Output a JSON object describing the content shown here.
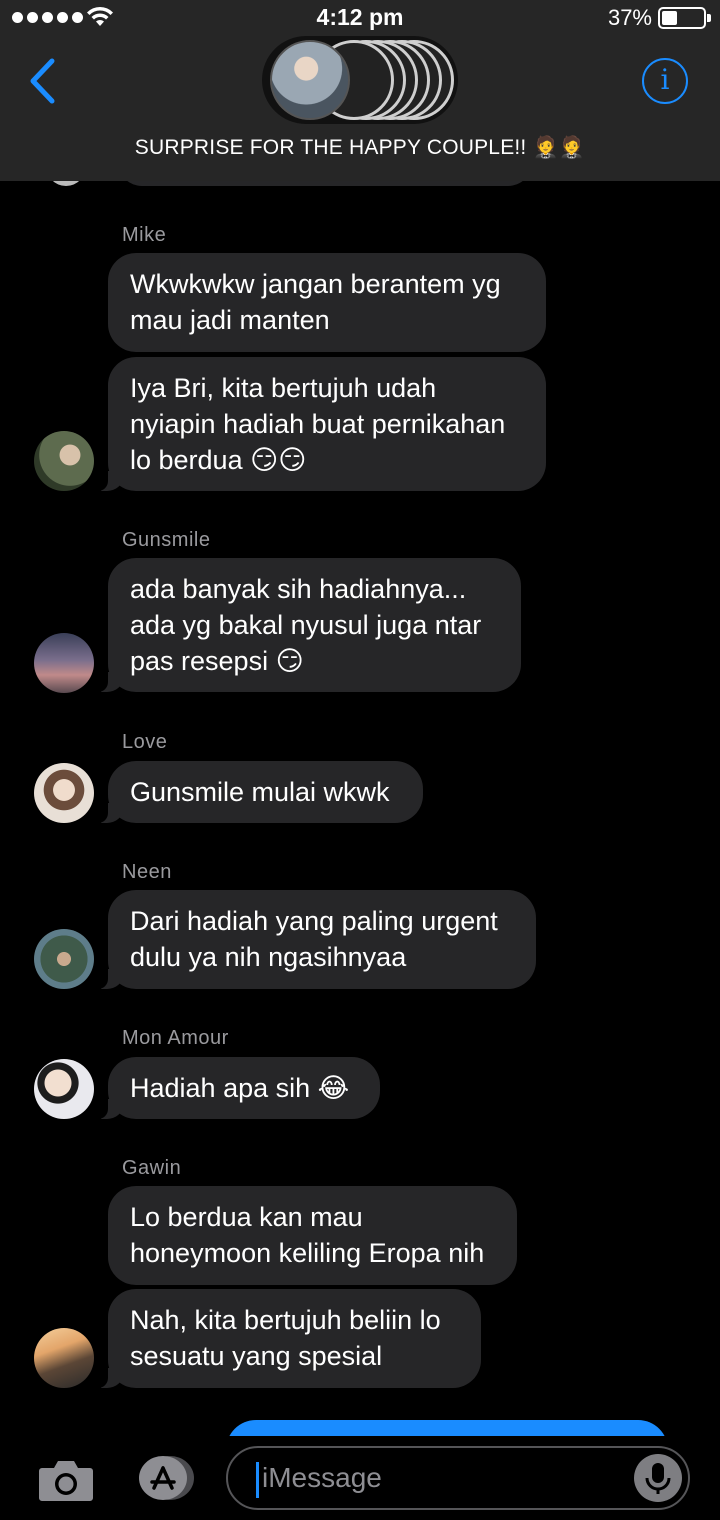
{
  "status_bar": {
    "time": "4:12 pm",
    "battery_percent": "37%",
    "battery_level": 0.37,
    "signal_bars": 5,
    "wifi_icon": "wifi-icon"
  },
  "header": {
    "group_title": "SURPRISE FOR THE HAPPY COUPLE!! 🤵🤵",
    "back_icon": "chevron-left-icon",
    "info_icon": "info-icon",
    "info_glyph": "i"
  },
  "messages": [
    {
      "sender": "Mike",
      "text": "Wkwkwkw jangan berantem yg\nmau jadi manten"
    },
    {
      "sender": "",
      "text": "Iya Bri, kita bertujuh udah\nnyiapin hadiah buat pernikahan\nlo berdua 😏😏"
    },
    {
      "sender": "Gunsmile",
      "text": "ada banyak sih hadiahnya...\nada yg bakal nyusul juga ntar\npas resepsi 😏"
    },
    {
      "sender": "Love",
      "text": "Gunsmile mulai wkwk"
    },
    {
      "sender": "Neen",
      "text": "Dari hadiah yang paling urgent\ndulu ya nih ngasihnyaa"
    },
    {
      "sender": "Mon Amour",
      "text": "Hadiah apa sih 😂"
    },
    {
      "sender": "Gawin",
      "text": "Lo berdua kan mau\nhoneymoon keliling Eropa nih"
    },
    {
      "sender": "",
      "text": "Nah, kita bertujuh beliin lo\nsesuatu yang spesial"
    }
  ],
  "input_bar": {
    "placeholder": "iMessage",
    "camera_icon": "camera-icon",
    "apps_icon": "app-store-icon",
    "mic_icon": "microphone-icon"
  },
  "colors": {
    "accent": "#1a8cff",
    "bubble": "#262628",
    "header": "#262626",
    "background": "#000000",
    "sender_name": "#9a9a9e"
  }
}
